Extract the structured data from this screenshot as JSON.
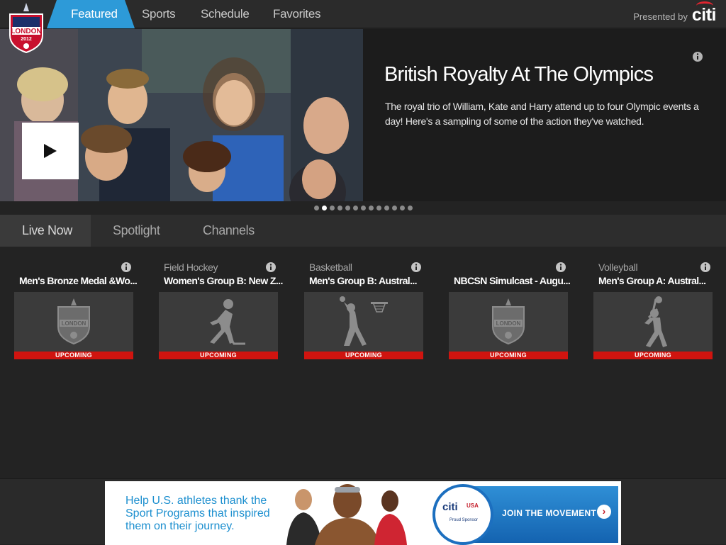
{
  "header": {
    "nav": [
      {
        "label": "Featured",
        "active": true
      },
      {
        "label": "Sports"
      },
      {
        "label": "Schedule"
      },
      {
        "label": "Favorites"
      }
    ],
    "presented_label": "Presented by",
    "sponsor": "citi",
    "logo_text": "LONDON",
    "logo_year": "2012",
    "accent_color": "#2d9ad8"
  },
  "hero": {
    "title": "British Royalty At The Olympics",
    "description": "The royal trio of William, Kate and Harry attend up to four Olympic events a day! Here's a sampling of some of the action they've watched.",
    "slide_count": 13,
    "active_slide": 1
  },
  "subtabs": [
    {
      "label": "Live Now",
      "active": true
    },
    {
      "label": "Spotlight"
    },
    {
      "label": "Channels"
    }
  ],
  "cards": [
    {
      "sport": "",
      "event": "Men's Bronze Medal &Wo...",
      "status": "UPCOMING",
      "icon": "london-2012-logo-icon"
    },
    {
      "sport": "Field Hockey",
      "event": "Women's Group B: New Z...",
      "status": "UPCOMING",
      "icon": "field-hockey-icon"
    },
    {
      "sport": "Basketball",
      "event": "Men's Group B: Austral...",
      "status": "UPCOMING",
      "icon": "basketball-icon"
    },
    {
      "sport": "",
      "event": "NBCSN Simulcast - Augu...",
      "status": "UPCOMING",
      "icon": "london-2012-logo-icon"
    },
    {
      "sport": "Volleyball",
      "event": "Men's Group A: Austral...",
      "status": "UPCOMING",
      "icon": "volleyball-icon"
    }
  ],
  "ad": {
    "line1": "Help U.S. athletes thank the",
    "line2": "Sport Programs that inspired",
    "line3": "them on their journey.",
    "brand": "citi",
    "partner": "USA",
    "sponsor_label": "Proud Sponsor",
    "cta": "JOIN THE MOVEMENT"
  }
}
